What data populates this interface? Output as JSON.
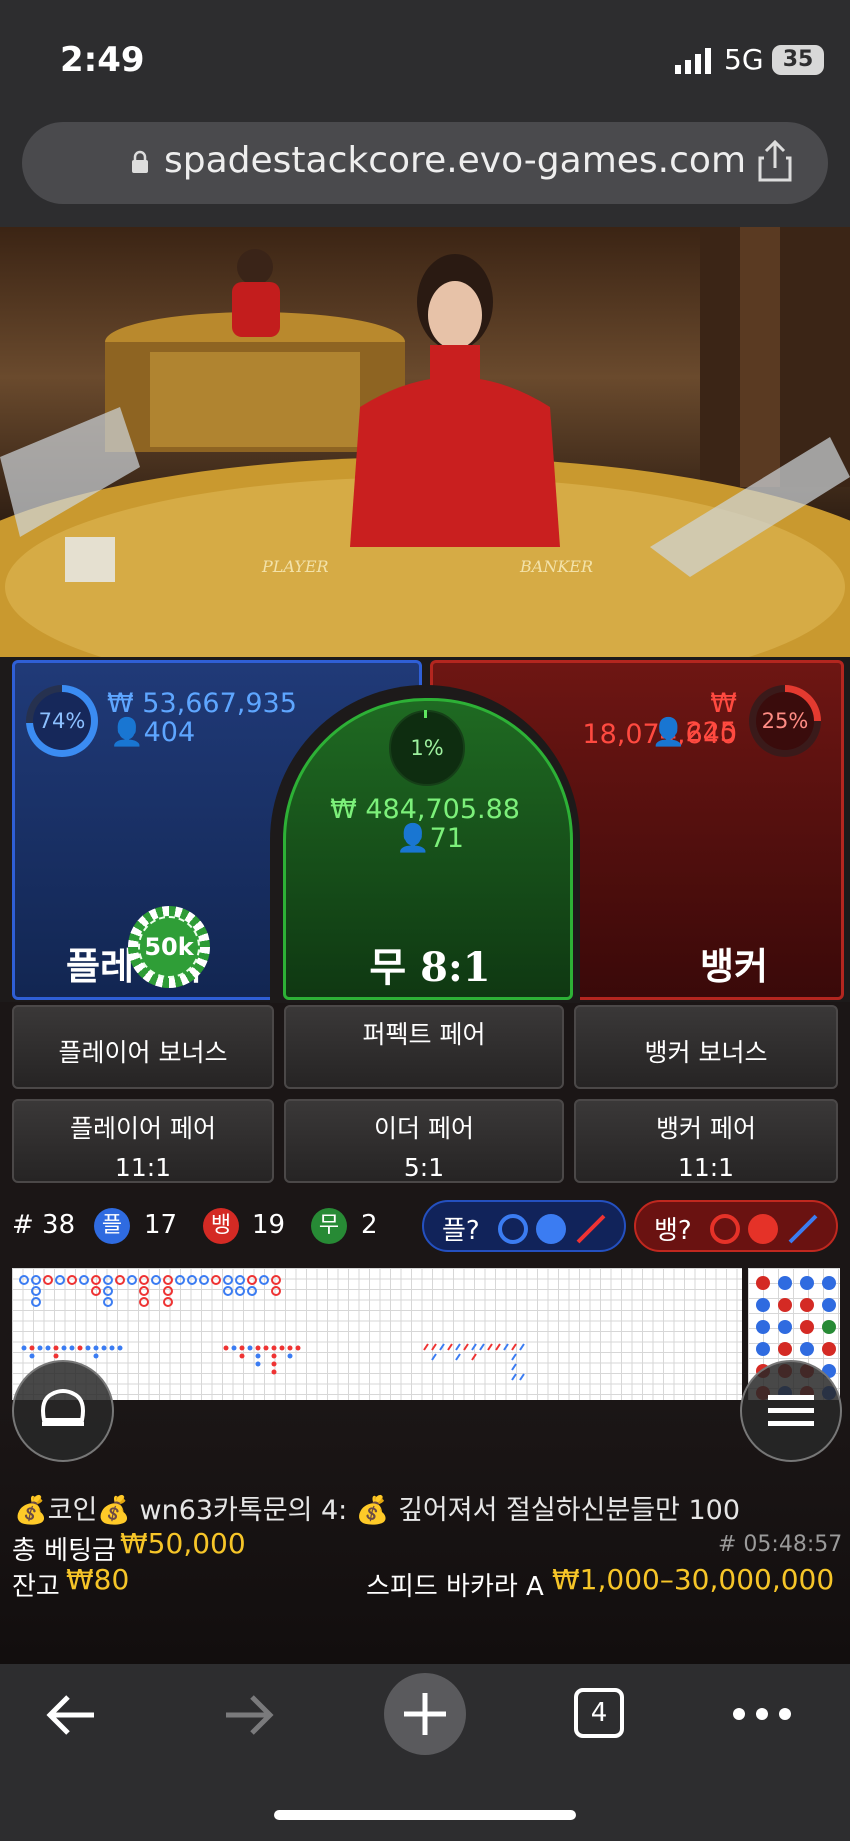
{
  "status": {
    "time": "2:49",
    "network": "5G",
    "battery": "35"
  },
  "browser": {
    "url": "spadestackcore.evo-games.com"
  },
  "video": {
    "table_text_left": "PLAYER",
    "table_text_right": "BANKER"
  },
  "bets": {
    "player": {
      "percent": "74%",
      "amount": "₩ 53,667,935",
      "count": "404",
      "label": "플레이어",
      "fraction": 0.74
    },
    "tie": {
      "percent": "1%",
      "amount": "₩ 484,705.88",
      "count": "71",
      "label": "무 8:1"
    },
    "banker": {
      "percent": "25%",
      "amount": "₩ 18,074,640",
      "count": "225",
      "label": "뱅커",
      "fraction": 0.25
    },
    "chip": "50k"
  },
  "side_bets": [
    {
      "label": "플레이어 보너스",
      "odds": ""
    },
    {
      "label": "퍼펙트 페어",
      "odds": ""
    },
    {
      "label": "뱅커 보너스",
      "odds": ""
    },
    {
      "label": "플레이어 페어",
      "odds": "11:1"
    },
    {
      "label": "이더 페어",
      "odds": "5:1"
    },
    {
      "label": "뱅커 페어",
      "odds": "11:1"
    }
  ],
  "stats": {
    "round": "# 38",
    "player_icon": "플",
    "player_wins": "17",
    "banker_icon": "뱅",
    "banker_wins": "19",
    "tie_icon": "무",
    "ties": "2",
    "player_predict": "플?",
    "banker_predict": "뱅?"
  },
  "info": {
    "chat_user": "💰코인💰 wn63카톡문의 4:",
    "chat_msg": "💰 깊어져서 절실하신분들만 100",
    "total_bet_label": "총 베팅금",
    "total_bet": "₩50,000",
    "game_id": "# 05:48:57",
    "balance_label": "잔고",
    "balance": "₩80",
    "table_name": "스피드 바카라 A",
    "limits": "₩1,000–30,000,000"
  },
  "toolbar": {
    "tabs_count": "4"
  },
  "colors": {
    "player": "#2f5fd6",
    "banker": "#b3261f",
    "tie": "#2db136",
    "gold": "#f6c528"
  }
}
